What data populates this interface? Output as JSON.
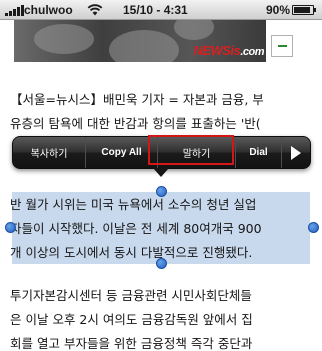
{
  "status_bar": {
    "carrier": "chulwoo",
    "time": "15/10 - 4:31",
    "battery_percent": "90%",
    "battery_level": 0.9
  },
  "article_image": {
    "logo_text": "NEWSis",
    "logo_suffix": ".com"
  },
  "article": {
    "paragraph1": [
      "【서울=뉴시스】배민욱 기자 = 자본과 금융, 부",
      "유층의 탐욕에 대한 반감과 항의를 표출하는 '반(",
      ""
    ],
    "paragraph2_selected": [
      "반 월가 시위는 미국 뉴욕에서 소수의 청년 실업",
      "자들이 시작했다. 이날은 전 세계 80여개국 900",
      "개 이상의 도시에서 동시 다발적으로 진행됐다."
    ],
    "paragraph3": [
      "투기자본감시센터 등 금융관련 시민사회단체들",
      "은 이날 오후 2시 여의도 금융감독원 앞에서 집",
      "회를 열고 부자들을 위한 금융정책 즉각 중단과"
    ]
  },
  "context_menu": {
    "items": [
      "복사하기",
      "Copy All",
      "말하기",
      "Dial"
    ],
    "more_icon": "arrow-right-icon"
  },
  "colors": {
    "selection": "#5a8cc8",
    "highlight": "#d41616",
    "menu_bg": "#1b1b1b"
  }
}
